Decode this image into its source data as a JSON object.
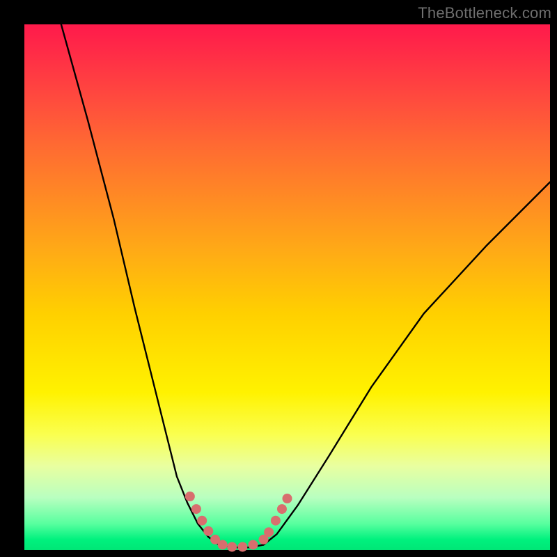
{
  "watermark": "TheBottleneck.com",
  "chart_data": {
    "type": "line",
    "title": "",
    "xlabel": "",
    "ylabel": "",
    "xlim": [
      0,
      1
    ],
    "ylim": [
      0,
      1
    ],
    "description": "A V-shaped black curve over a vertical rainbow gradient (red at top through yellow to green at bottom). No axis tick labels visible.",
    "series": [
      {
        "name": "left-branch",
        "stroke": "#000000",
        "stroke_width": 2.4,
        "x": [
          0.07,
          0.12,
          0.17,
          0.21,
          0.25,
          0.29,
          0.31,
          0.33,
          0.35,
          0.37
        ],
        "y": [
          1.0,
          0.82,
          0.63,
          0.46,
          0.3,
          0.14,
          0.09,
          0.05,
          0.025,
          0.01
        ]
      },
      {
        "name": "valley-flat",
        "stroke": "#000000",
        "stroke_width": 2.4,
        "x": [
          0.37,
          0.4,
          0.43,
          0.455
        ],
        "y": [
          0.01,
          0.005,
          0.005,
          0.01
        ]
      },
      {
        "name": "right-branch",
        "stroke": "#000000",
        "stroke_width": 2.4,
        "x": [
          0.455,
          0.48,
          0.52,
          0.58,
          0.66,
          0.76,
          0.88,
          1.0
        ],
        "y": [
          0.01,
          0.03,
          0.085,
          0.18,
          0.31,
          0.45,
          0.58,
          0.7
        ]
      }
    ],
    "markers": [
      {
        "name": "valley-markers",
        "color": "#d86e6e",
        "radius": 7,
        "points": [
          {
            "x": 0.315,
            "y": 0.102
          },
          {
            "x": 0.327,
            "y": 0.078
          },
          {
            "x": 0.338,
            "y": 0.056
          },
          {
            "x": 0.35,
            "y": 0.036
          },
          {
            "x": 0.363,
            "y": 0.02
          },
          {
            "x": 0.377,
            "y": 0.01
          },
          {
            "x": 0.395,
            "y": 0.006
          },
          {
            "x": 0.415,
            "y": 0.006
          },
          {
            "x": 0.435,
            "y": 0.01
          },
          {
            "x": 0.455,
            "y": 0.02
          },
          {
            "x": 0.465,
            "y": 0.034
          },
          {
            "x": 0.478,
            "y": 0.056
          },
          {
            "x": 0.49,
            "y": 0.078
          },
          {
            "x": 0.5,
            "y": 0.098
          }
        ]
      }
    ]
  },
  "colors": {
    "marker": "#d86e6e",
    "curve": "#000000",
    "watermark": "#6f6f6f"
  }
}
